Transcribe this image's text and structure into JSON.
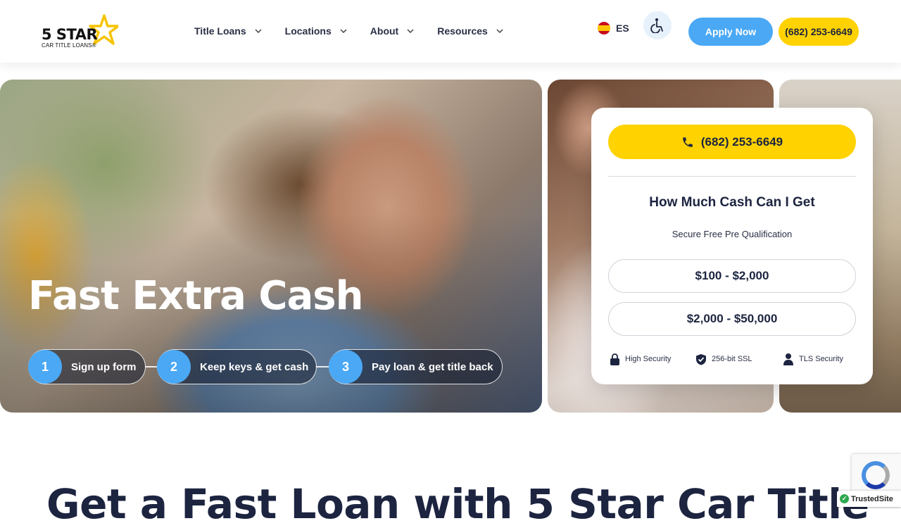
{
  "header": {
    "logo": {
      "main": "5 STAR",
      "sub": "CAR TITLE LOANS®",
      "star_color": "#f6c400"
    },
    "nav": [
      {
        "label": "Title Loans"
      },
      {
        "label": "Locations"
      },
      {
        "label": "About"
      },
      {
        "label": "Resources"
      }
    ],
    "lang": {
      "label": "ES",
      "flag": "spain-flag-icon"
    },
    "accessibility_icon": "wheelchair-icon",
    "apply_label": "Apply Now",
    "phone_label": "(682) 253-6649"
  },
  "hero": {
    "title": "Fast Extra Cash",
    "steps": [
      {
        "num": "1",
        "label": "Sign up form"
      },
      {
        "num": "2",
        "label": "Keep keys & get cash"
      },
      {
        "num": "3",
        "label": "Pay loan & get title back"
      }
    ]
  },
  "card": {
    "phone_label": "(682) 253-6649",
    "title": "How Much Cash Can I Get",
    "subtitle": "Secure Free Pre Qualification",
    "ranges": [
      "$100 - $2,000",
      "$2,000 - $50,000"
    ],
    "security": [
      {
        "label": "High Security",
        "icon": "lock-icon"
      },
      {
        "label": "256-bit SSL",
        "icon": "shield-check-icon"
      },
      {
        "label": "TLS Security",
        "icon": "user-icon"
      }
    ]
  },
  "bottom_heading": "Get a Fast Loan with 5 Star Car Title",
  "badges": {
    "trusted": "TrustedSite"
  },
  "colors": {
    "accent_blue": "#4aa8f5",
    "accent_yellow": "#ffd200",
    "text_dark": "#1c2440"
  }
}
